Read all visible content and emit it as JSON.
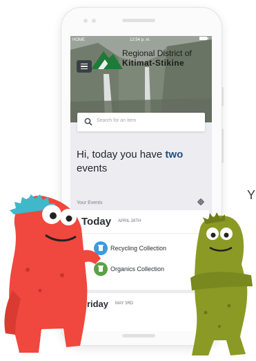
{
  "status_bar": {
    "carrier": "HOME",
    "time": "12:54 p. m."
  },
  "header": {
    "logo_line1": "Regional District of",
    "logo_line2": "Kitimat-Stikine"
  },
  "search": {
    "placeholder": "Search for an item"
  },
  "greeting": {
    "prefix": "Hi, today you have ",
    "count": "two",
    "suffix": "events"
  },
  "events_section": {
    "label": "Your Events"
  },
  "days": [
    {
      "title": "Today",
      "date": "APRIL 26TH",
      "events": [
        {
          "label": "Recycling Collection",
          "icon": "recycling-bin-icon",
          "color": "#3b9bdc"
        },
        {
          "label": "Organics Collection",
          "icon": "organics-bin-icon",
          "color": "#5aa246"
        }
      ]
    },
    {
      "title": "Friday",
      "date": "MAY 3RD"
    }
  ],
  "side_text": "Y",
  "colors": {
    "accent": "#214f7c",
    "recycling": "#3b9bdc",
    "organics": "#5aa246",
    "monster_red": "#f0473e",
    "monster_green": "#8b9a25"
  }
}
